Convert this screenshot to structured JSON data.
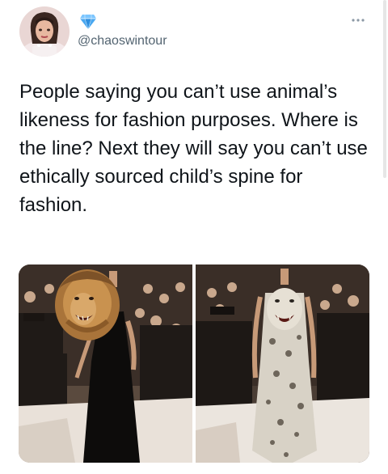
{
  "author": {
    "handle": "@chaoswintour"
  },
  "tweet": {
    "text": "People saying you can’t use animal’s likeness for fashion purposes. Where is the line? Next they will say you can’t use ethically sourced child’s spine for fashion."
  },
  "icons": {
    "verified": "blue-diamond-icon",
    "more": "more-options-icon"
  },
  "colors": {
    "text": "#0f1419",
    "secondary_text": "#536471",
    "verified_blue": "#4aa8f0"
  },
  "media": {
    "photos": [
      "photo-lion-head-gown",
      "photo-snow-leopard-gown"
    ]
  }
}
